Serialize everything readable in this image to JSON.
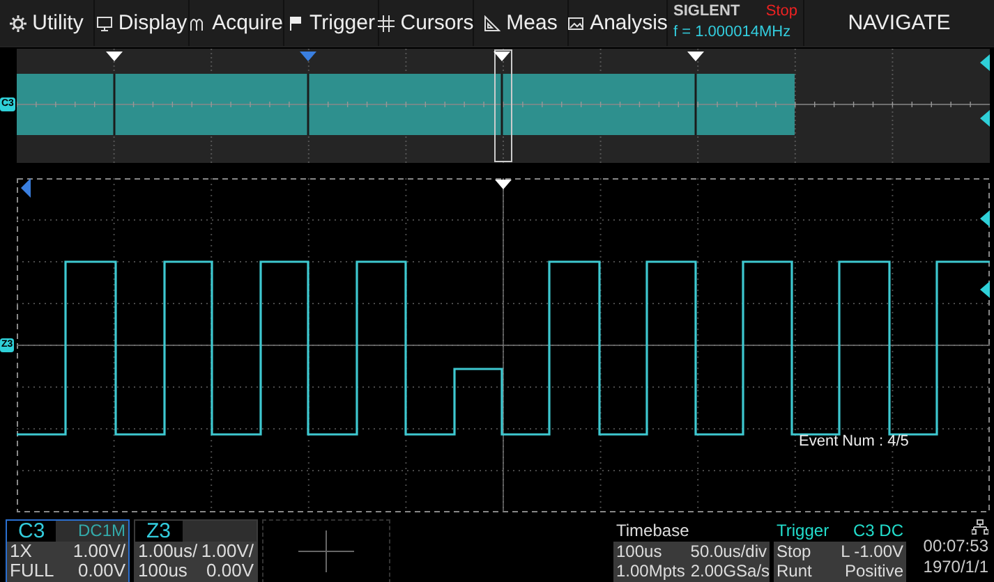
{
  "menu": [
    {
      "label": "Utility"
    },
    {
      "label": "Display"
    },
    {
      "label": "Acquire"
    },
    {
      "label": "Trigger"
    },
    {
      "label": "Cursors"
    },
    {
      "label": "Meas"
    },
    {
      "label": "Analysis"
    }
  ],
  "status": {
    "brand": "SIGLENT",
    "state": "Stop",
    "frequency": "f = 1.000014MHz"
  },
  "navigate": "NAVIGATE",
  "overview": {
    "channel_tag": "C3"
  },
  "main": {
    "channel_tag": "Z3",
    "event_num": "Event Num : 4/5"
  },
  "channel_panels": [
    {
      "name": "C3",
      "coupling": "DC1M",
      "selected": true,
      "rows": [
        [
          "1X",
          "1.00V/"
        ],
        [
          "FULL",
          "0.00V"
        ]
      ]
    },
    {
      "name": "Z3",
      "selected": false,
      "rows": [
        [
          "1.00us/",
          "1.00V/"
        ],
        [
          "100us",
          "0.00V"
        ]
      ]
    }
  ],
  "timebase": {
    "title": "Timebase",
    "rows": [
      [
        "100us",
        "50.0us/div"
      ],
      [
        "1.00Mpts",
        "2.00GSa/s"
      ]
    ]
  },
  "trigger": {
    "title": "Trigger",
    "source": "C3 DC",
    "rows": [
      [
        "Stop",
        "L -1.00V"
      ],
      [
        "Runt",
        "Positive"
      ]
    ]
  },
  "clock": {
    "time": "00:07:53",
    "date": "1970/1/1"
  }
}
